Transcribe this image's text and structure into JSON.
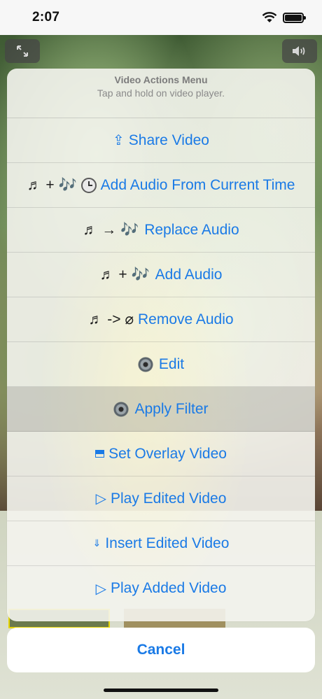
{
  "status_bar": {
    "time": "2:07"
  },
  "sheet": {
    "title": "Video Actions Menu",
    "subtitle": "Tap and hold on video player.",
    "items": [
      {
        "icon": "⇪",
        "pre": "",
        "label": "Share Video"
      },
      {
        "pre": "♬ + 🎶",
        "label": "Add Audio From Current Time"
      },
      {
        "pre": "♬ → 🎶",
        "label": "Replace Audio"
      },
      {
        "pre": "♬ + 🎶",
        "label": "Add Audio"
      },
      {
        "pre": "♬ -> ⌀",
        "label": "Remove Audio"
      },
      {
        "label": "Edit"
      },
      {
        "label": "Apply Filter"
      },
      {
        "label": "Set Overlay Video"
      },
      {
        "icon": "▷",
        "label": "Play Edited Video"
      },
      {
        "icon": "⇓",
        "label": "Insert Edited Video"
      },
      {
        "icon": "▷",
        "label": "Play Added Video"
      }
    ]
  },
  "cancel": {
    "label": "Cancel"
  },
  "colors": {
    "action_blue": "#1a7ae6",
    "highlight_row": "Apply Filter"
  },
  "icons": {
    "share": "share-icon",
    "audio": "music-note-icon",
    "clock": "clock-icon",
    "gear": "gear-icon",
    "overlay": "overlay-icon",
    "play": "play-icon",
    "insert": "insert-icon",
    "expand": "expand-icon",
    "volume": "volume-icon"
  }
}
